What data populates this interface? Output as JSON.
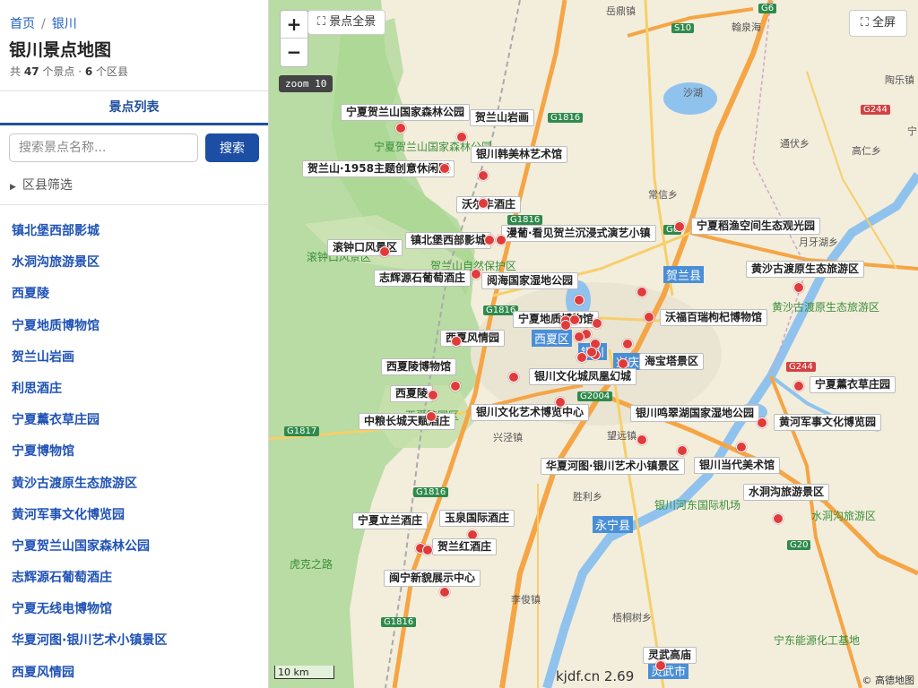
{
  "sidebar": {
    "breadcrumb": {
      "home": "首页",
      "sep": "/",
      "current": "银川"
    },
    "title": "银川景点地图",
    "stats": {
      "prefix": "共",
      "spots": "47",
      "mid": "个景点 ·",
      "districts": "6",
      "suffix": "个区县"
    },
    "tab_label": "景点列表",
    "search": {
      "placeholder": "搜索景点名称...",
      "button": "搜索"
    },
    "filter_label": "区县筛选",
    "items": [
      "镇北堡西部影城",
      "水洞沟旅游景区",
      "西夏陵",
      "宁夏地质博物馆",
      "贺兰山岩画",
      "利思酒庄",
      "宁夏薰衣草庄园",
      "宁夏博物馆",
      "黄沙古渡原生态旅游区",
      "黄河军事文化博览园",
      "宁夏贺兰山国家森林公园",
      "志辉源石葡萄酒庄",
      "宁夏无线电博物馆",
      "华夏河图·银川艺术小镇景区",
      "西夏风情园"
    ]
  },
  "map": {
    "zoom_in": "+",
    "zoom_out": "−",
    "full_view": "⛶ 景点全景",
    "full_screen": "⛶ 全屏",
    "zoom_level": "zoom 10",
    "scale": "10 km",
    "watermark": "kjdf.cn 2.69",
    "copyright": "© 高德地图",
    "colors": {
      "marker": "#e03b3b",
      "water": "#8fc3ee",
      "forest": "#b7dca2",
      "road_major": "#f5a545",
      "road_minor": "#f7cf6a"
    },
    "markers": [
      {
        "label": "宁夏贺兰山国家森林公园"
      },
      {
        "label": "贺兰山岩画"
      },
      {
        "label": "银川韩美林艺术馆"
      },
      {
        "label": "贺兰山·1958主题创意休闲区"
      },
      {
        "label": "沃尔丰酒庄"
      },
      {
        "label": "滚钟口风景区"
      },
      {
        "label": "镇北堡西部影城"
      },
      {
        "label": "漫葡·看见贺兰沉浸式演艺小镇"
      },
      {
        "label": "宁夏稻渔空间生态观光园"
      },
      {
        "label": "志辉源石葡萄酒庄"
      },
      {
        "label": "阅海国家湿地公园"
      },
      {
        "label": "黄沙古渡原生态旅游区"
      },
      {
        "label": "宁夏地质博物馆"
      },
      {
        "label": "沃福百瑞枸杞博物馆"
      },
      {
        "label": "西夏风情园"
      },
      {
        "label": "海宝塔景区"
      },
      {
        "label": "西夏陵博物馆"
      },
      {
        "label": "银川文化城凤凰幻城"
      },
      {
        "label": "宁夏薰衣草庄园"
      },
      {
        "label": "西夏陵"
      },
      {
        "label": "银川文化艺术博览中心"
      },
      {
        "label": "银川鸣翠湖国家湿地公园"
      },
      {
        "label": "中粮长城天赋酒庄"
      },
      {
        "label": "黄河军事文化博览园"
      },
      {
        "label": "华夏河图·银川艺术小镇景区"
      },
      {
        "label": "银川当代美术馆"
      },
      {
        "label": "水洞沟旅游景区"
      },
      {
        "label": "宁夏立兰酒庄"
      },
      {
        "label": "玉泉国际酒庄"
      },
      {
        "label": "贺兰红酒庄"
      },
      {
        "label": "闽宁新貌展示中心"
      },
      {
        "label": "灵武高庙"
      }
    ],
    "places": [
      "岳鼎镇",
      "翰泉海",
      "沙湖",
      "陶乐镇",
      "通伏乡",
      "高仁乡",
      "常信乡",
      "月牙湖乡",
      "贺兰县",
      "兴泾镇",
      "望远镇",
      "胜利乡",
      "李俊镇",
      "梧桐树乡",
      "宁东能源化工基地",
      "虎克之路",
      "宁夏贺兰山国家森林公园",
      "贺兰山自然保护区",
      "滚钟口风景区",
      "西夏陵园区",
      "黄沙古渡原生态旅游区",
      "水洞沟旅游区",
      "银川河东国际机场",
      "银川",
      "西夏区",
      "兴庆区",
      "永宁县",
      "灵武市",
      "宁"
    ],
    "routes": [
      "G6",
      "S10",
      "G1816",
      "G244",
      "G20",
      "G1817",
      "G2004"
    ]
  }
}
